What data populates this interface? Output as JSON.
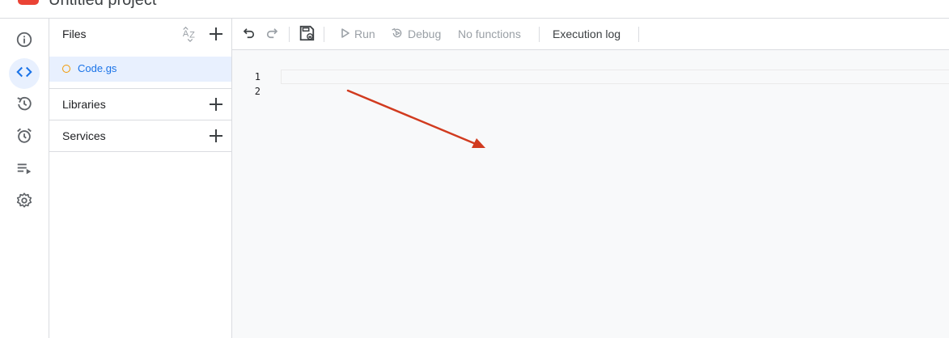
{
  "header": {
    "title": "Untitled project"
  },
  "nav_rail": {
    "items": [
      {
        "name": "overview-icon",
        "active": false
      },
      {
        "name": "editor-icon",
        "active": true
      },
      {
        "name": "history-icon",
        "active": false
      },
      {
        "name": "triggers-icon",
        "active": false
      },
      {
        "name": "executions-icon",
        "active": false
      },
      {
        "name": "settings-icon",
        "active": false
      }
    ]
  },
  "files_panel": {
    "files_label": "Files",
    "files": [
      {
        "name": "Code.gs"
      }
    ],
    "libraries_label": "Libraries",
    "services_label": "Services"
  },
  "toolbar": {
    "run_label": "Run",
    "debug_label": "Debug",
    "function_select": "No functions",
    "execution_log_label": "Execution log"
  },
  "editor": {
    "line_numbers": [
      "1",
      "2"
    ]
  },
  "colors": {
    "accent": "#1a73e8",
    "active_bg": "#e8f0fe",
    "file_dot": "#f29900",
    "annotation_arrow": "#d13b1f"
  }
}
